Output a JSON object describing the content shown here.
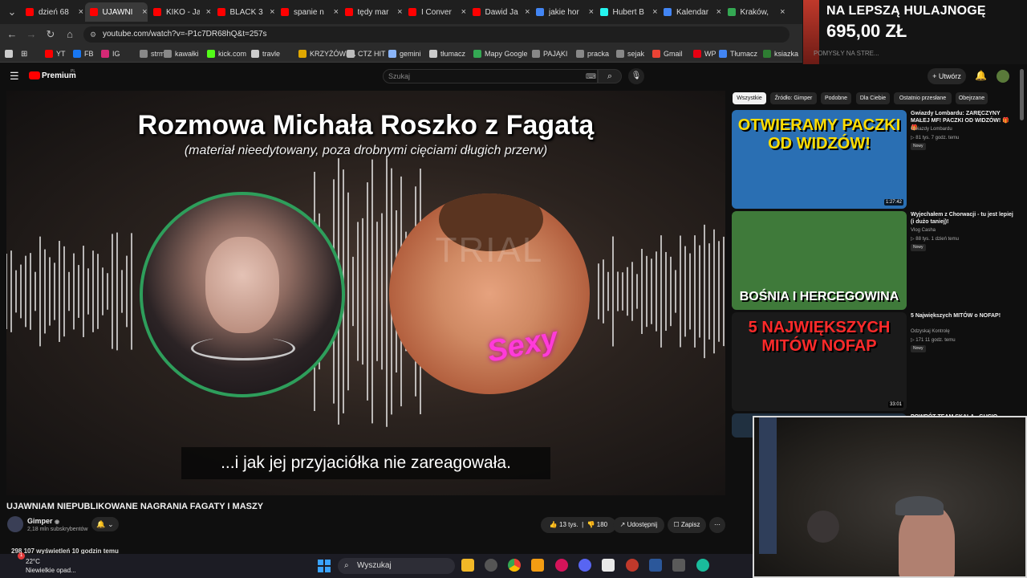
{
  "tabs": [
    {
      "label": "dzień 68",
      "color": "#ff0000"
    },
    {
      "label": "UJAWNI",
      "color": "#ff0000"
    },
    {
      "label": "KIKO - Ja",
      "color": "#ff0000"
    },
    {
      "label": "BLACK 3",
      "color": "#ff0000"
    },
    {
      "label": "spanie n",
      "color": "#ff0000"
    },
    {
      "label": "tędy mar",
      "color": "#ff0000"
    },
    {
      "label": "I Conver",
      "color": "#ff0000"
    },
    {
      "label": "Dawid Ja",
      "color": "#ff0000"
    },
    {
      "label": "jakie hor",
      "color": "#4285f4"
    },
    {
      "label": "Hubert B",
      "color": "#25f4ee"
    },
    {
      "label": "Kalendar",
      "color": "#4285f4"
    },
    {
      "label": "Kraków,",
      "color": "#34a853"
    }
  ],
  "address": {
    "url": "youtube.com/watch?v=-P1c7DR68hQ&t=257s"
  },
  "bookmarks": [
    {
      "label": "YT",
      "color": "#ff0000"
    },
    {
      "label": "FB",
      "color": "#1877f2"
    },
    {
      "label": "IG",
      "color": "#d62976"
    },
    {
      "label": "strm",
      "color": "#888888"
    },
    {
      "label": "kawałki",
      "color": "#888888"
    },
    {
      "label": "kick.com",
      "color": "#53fc18"
    },
    {
      "label": "travle",
      "color": "#cccccc"
    },
    {
      "label": "KRZYŻÓWKA",
      "color": "#e0a800"
    },
    {
      "label": "CTZ HIT",
      "color": "#bbbbbb"
    },
    {
      "label": "gemini",
      "color": "#8ab4f8"
    },
    {
      "label": "tłumacz",
      "color": "#cccccc"
    },
    {
      "label": "Mapy Google",
      "color": "#34a853"
    },
    {
      "label": "PAJĄKI",
      "color": "#888888"
    },
    {
      "label": "pracka",
      "color": "#888888"
    },
    {
      "label": "sejak",
      "color": "#888888"
    },
    {
      "label": "Gmail",
      "color": "#ea4335"
    },
    {
      "label": "WP",
      "color": "#e60012"
    },
    {
      "label": "Tłumacz",
      "color": "#4285f4"
    },
    {
      "label": "ksiazka",
      "color": "#2e7d32"
    }
  ],
  "promo": {
    "line1": "NA LEPSZĄ HULAJNOGĘ",
    "line2": "695,00 ZŁ",
    "ghost": "POMYSŁY NA STRE..."
  },
  "youtube": {
    "logo": "Premium",
    "logo_sup": "PL",
    "search_placeholder": "Szukaj",
    "create_label": "Utwórz"
  },
  "video": {
    "title": "Rozmowa Michała Roszko z Fagatą",
    "subtitle": "(materiał nieedytowany, poza drobnymi cięciami długich przerw)",
    "watermark": "TRIAL",
    "overlay_word": "Sexy",
    "caption": "...i jak jej przyjaciółka nie zareagowała."
  },
  "below": {
    "title": "UJAWNIAM NIEPUBLIKOWANE NAGRANIA FAGATY I MASZY",
    "channel": "Gimper",
    "subs": "2,18 mln subskrybentów",
    "likes": "13 tys.",
    "dislikes": "180",
    "share": "Udostępnij",
    "save": "Zapisz",
    "views": "298 107 wyświetleń  10 godzin temu"
  },
  "chips": [
    "Wszystkie",
    "Źródło: Gimper",
    "Podobne",
    "Dla Ciebie",
    "Ostatnio przesłane",
    "Obejrzane"
  ],
  "recommendations": [
    {
      "thumb_text": "OTWIERAMY PACZKI OD WIDZÓW!",
      "title": "Gwiazdy Lombardu: ZARĘCZYNY MAŁEJ MF! PACZKI OD WIDZÓW! 🎁 🎁",
      "channel": "Gwiazdy Lombardu",
      "meta": "▷ 81 tys.  7 godz. temu",
      "badge": "Nowy",
      "duration": "1:27:42",
      "bg": "#2a6fb3"
    },
    {
      "thumb_text": "BOŚNIA I HERCEGOWINA",
      "title": "Wyjechałem z Chorwacji - tu jest lepiej (i dużo taniej)!",
      "channel": "Vlog Casha",
      "meta": "▷ 88 tys.  1 dzień temu",
      "badge": "Nowy",
      "duration": "",
      "bg": "#3f7a3a"
    },
    {
      "thumb_text": "5 NAJWIĘKSZYCH MITÓW NOFAP",
      "title": "5 Największych MITÓW o NOFAP!",
      "channel": "Odzyskaj Kontrolę",
      "meta": "▷ 171  11 godz. temu",
      "badge": "Nowy",
      "duration": "33:01",
      "bg": "#1a1a1a"
    },
    {
      "thumb_text": "",
      "title": "POWRÓT TEAM SKALA - GUCIO",
      "channel": "",
      "meta": "",
      "badge": "",
      "duration": "",
      "bg": "#203040"
    }
  ],
  "taskbar": {
    "temp": "22°C",
    "weather": "Niewielkie opad...",
    "search": "Wyszukaj",
    "badge": "1"
  }
}
